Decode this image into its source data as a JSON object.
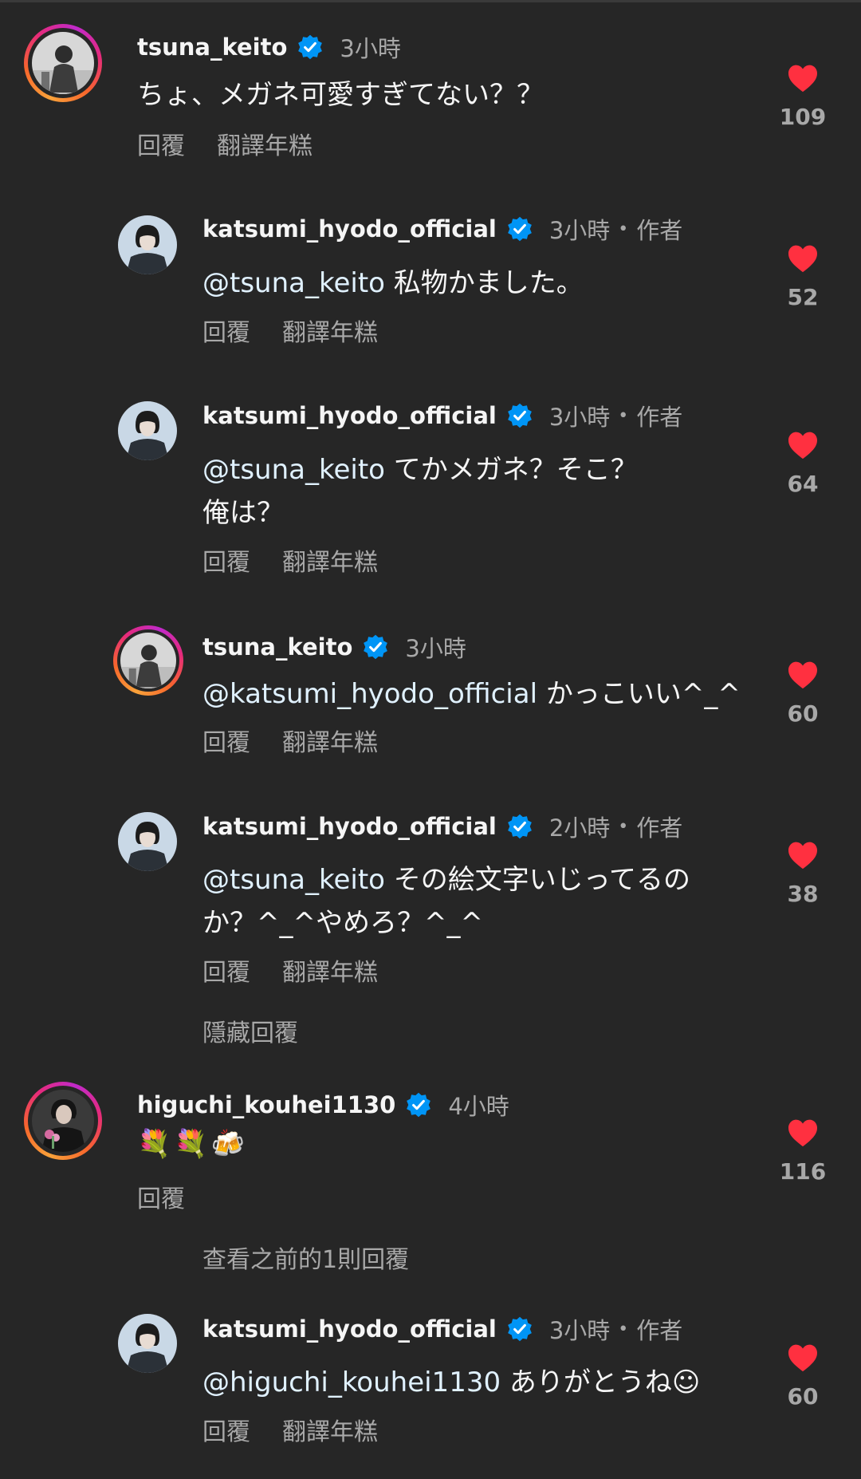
{
  "comments": [
    {
      "username": "tsuna_keito",
      "time": "3小時",
      "author_tag": "",
      "mention": "",
      "text": "ちょ、メガネ可愛すぎてない？？",
      "reply_label": "回覆",
      "translate_label": "翻譯年糕",
      "likes": "109"
    },
    {
      "username": "katsumi_hyodo_official",
      "time": "3小時",
      "author_tag": "作者",
      "mention": "@tsuna_keito",
      "text": " 私物かました。",
      "reply_label": "回覆",
      "translate_label": "翻譯年糕",
      "likes": "52"
    },
    {
      "username": "katsumi_hyodo_official",
      "time": "3小時",
      "author_tag": "作者",
      "mention": "@tsuna_keito",
      "text": " てかメガネ？そこ？\n俺は？",
      "reply_label": "回覆",
      "translate_label": "翻譯年糕",
      "likes": "64"
    },
    {
      "username": "tsuna_keito",
      "time": "3小時",
      "author_tag": "",
      "mention": "@katsumi_hyodo_official",
      "text": " かっこいい^_^",
      "reply_label": "回覆",
      "translate_label": "翻譯年糕",
      "likes": "60"
    },
    {
      "username": "katsumi_hyodo_official",
      "time": "2小時",
      "author_tag": "作者",
      "mention": "@tsuna_keito",
      "text": " その絵文字いじってるの\nか？^_^やめろ？^_^",
      "reply_label": "回覆",
      "translate_label": "翻譯年糕",
      "likes": "38"
    },
    {
      "username": "higuchi_kouhei1130",
      "time": "4小時",
      "author_tag": "",
      "mention": "",
      "text": "💐💐🍻",
      "reply_label": "回覆",
      "translate_label": "",
      "likes": "116"
    },
    {
      "username": "katsumi_hyodo_official",
      "time": "3小時",
      "author_tag": "作者",
      "mention": "@higuchi_kouhei1130",
      "text": " ありがとうね☺",
      "reply_label": "回覆",
      "translate_label": "翻譯年糕",
      "likes": "60"
    }
  ],
  "hide_replies_label": "隱藏回覆",
  "view_previous_label": "查看之前的1則回覆",
  "colors": {
    "background": "#262626",
    "verified": "#0095f6",
    "like": "#ff3040",
    "secondary_text": "#a8a8a8"
  },
  "icons": {
    "verified": "verified-badge-icon",
    "like": "heart-icon"
  }
}
